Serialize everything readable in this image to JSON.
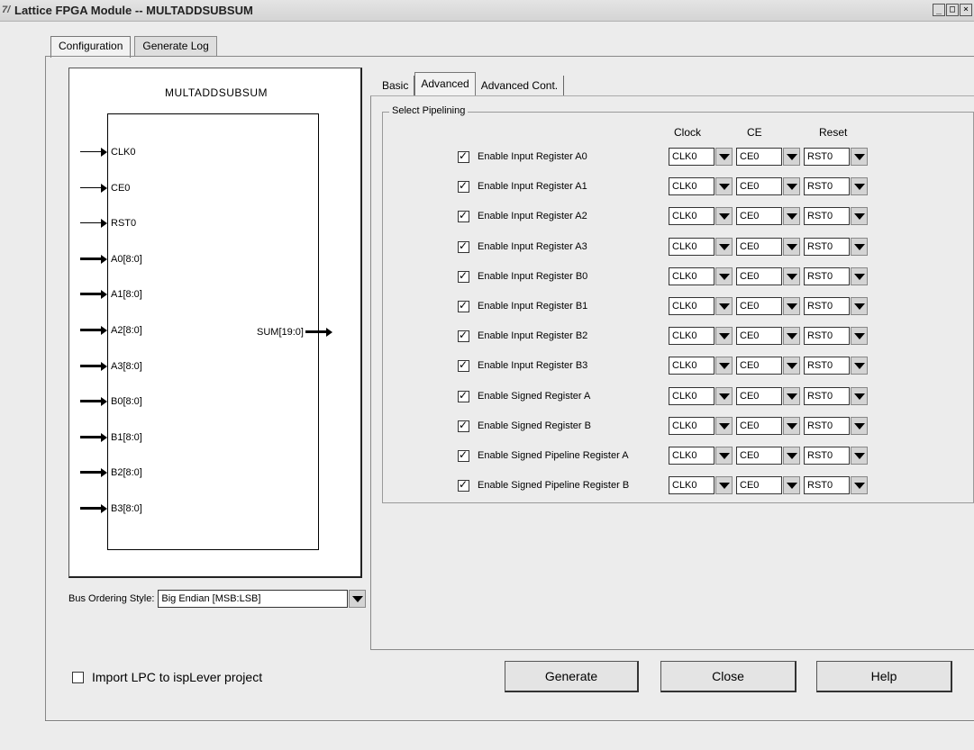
{
  "window": {
    "app_icon": "7/",
    "title": "Lattice FPGA Module -- MULTADDSUBSUM",
    "buttons": [
      "_",
      "□",
      "×"
    ]
  },
  "outer_tabs": [
    {
      "label": "Configuration",
      "active": true
    },
    {
      "label": "Generate Log",
      "active": false
    }
  ],
  "diagram": {
    "title": "MULTADDSUBSUM",
    "inputs": [
      {
        "label": "CLK0",
        "bus": false
      },
      {
        "label": "CE0",
        "bus": false
      },
      {
        "label": "RST0",
        "bus": false
      },
      {
        "label": "A0[8:0]",
        "bus": true
      },
      {
        "label": "A1[8:0]",
        "bus": true
      },
      {
        "label": "A2[8:0]",
        "bus": true
      },
      {
        "label": "A3[8:0]",
        "bus": true
      },
      {
        "label": "B0[8:0]",
        "bus": true
      },
      {
        "label": "B1[8:0]",
        "bus": true
      },
      {
        "label": "B2[8:0]",
        "bus": true
      },
      {
        "label": "B3[8:0]",
        "bus": true
      }
    ],
    "output": "SUM[19:0]"
  },
  "bus_order": {
    "label": "Bus Ordering Style:",
    "value": "Big Endian [MSB:LSB]"
  },
  "inner_tabs": [
    {
      "label": "Basic",
      "active": false
    },
    {
      "label": "Advanced",
      "active": true
    },
    {
      "label": "Advanced Cont.",
      "active": false
    }
  ],
  "pipelining": {
    "title": "Select Pipelining",
    "col_clock": "Clock",
    "col_ce": "CE",
    "col_reset": "Reset",
    "rows": [
      {
        "label": "Enable Input Register A0",
        "checked": true,
        "clock": "CLK0",
        "ce": "CE0",
        "reset": "RST0"
      },
      {
        "label": "Enable Input Register A1",
        "checked": true,
        "clock": "CLK0",
        "ce": "CE0",
        "reset": "RST0"
      },
      {
        "label": "Enable Input Register A2",
        "checked": true,
        "clock": "CLK0",
        "ce": "CE0",
        "reset": "RST0"
      },
      {
        "label": "Enable Input Register A3",
        "checked": true,
        "clock": "CLK0",
        "ce": "CE0",
        "reset": "RST0"
      },
      {
        "label": "Enable Input Register B0",
        "checked": true,
        "clock": "CLK0",
        "ce": "CE0",
        "reset": "RST0"
      },
      {
        "label": "Enable Input Register B1",
        "checked": true,
        "clock": "CLK0",
        "ce": "CE0",
        "reset": "RST0"
      },
      {
        "label": "Enable Input Register B2",
        "checked": true,
        "clock": "CLK0",
        "ce": "CE0",
        "reset": "RST0"
      },
      {
        "label": "Enable Input Register B3",
        "checked": true,
        "clock": "CLK0",
        "ce": "CE0",
        "reset": "RST0"
      },
      {
        "label": "Enable Signed Register A",
        "checked": true,
        "clock": "CLK0",
        "ce": "CE0",
        "reset": "RST0"
      },
      {
        "label": "Enable Signed Register B",
        "checked": true,
        "clock": "CLK0",
        "ce": "CE0",
        "reset": "RST0"
      },
      {
        "label": "Enable Signed Pipeline Register A",
        "checked": true,
        "clock": "CLK0",
        "ce": "CE0",
        "reset": "RST0"
      },
      {
        "label": "Enable Signed Pipeline Register B",
        "checked": true,
        "clock": "CLK0",
        "ce": "CE0",
        "reset": "RST0"
      }
    ]
  },
  "import_lpc": {
    "label": "Import LPC to ispLever project",
    "checked": false
  },
  "actions": {
    "generate": "Generate",
    "close": "Close",
    "help": "Help"
  }
}
